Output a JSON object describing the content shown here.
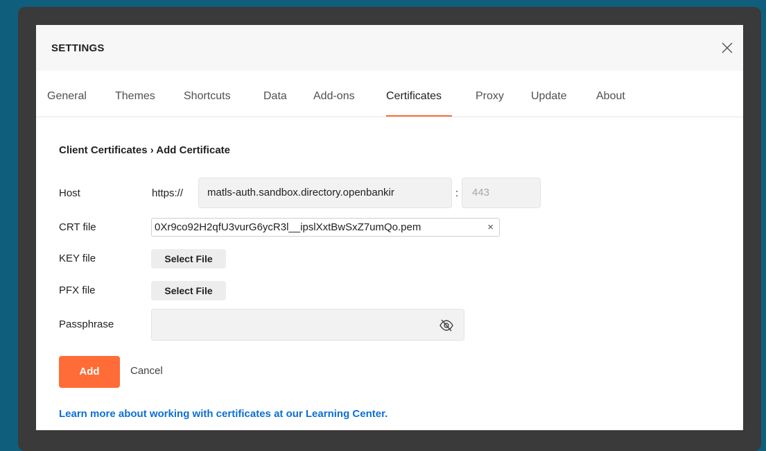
{
  "dialog": {
    "title": "SETTINGS",
    "close_icon": "close-icon"
  },
  "tabs": [
    {
      "label": "General"
    },
    {
      "label": "Themes"
    },
    {
      "label": "Shortcuts"
    },
    {
      "label": "Data"
    },
    {
      "label": "Add-ons"
    },
    {
      "label": "Certificates",
      "active": true
    },
    {
      "label": "Proxy"
    },
    {
      "label": "Update"
    },
    {
      "label": "About"
    }
  ],
  "breadcrumb": "Client Certificates › Add Certificate",
  "form": {
    "host_label": "Host",
    "protocol": "https://",
    "host_value": "matls-auth.sandbox.directory.openbankir",
    "colon": ":",
    "port_placeholder": "443",
    "crt_label": "CRT file",
    "crt_value": "0Xr9co92H2qfU3vurG6ycR3l__ipslXxtBwSxZ7umQo.pem",
    "crt_remove": "×",
    "key_label": "KEY file",
    "key_button": "Select File",
    "pfx_label": "PFX file",
    "pfx_button": "Select File",
    "passphrase_label": "Passphrase",
    "passphrase_value": "",
    "passphrase_icon": "eye-off-icon"
  },
  "actions": {
    "add_label": "Add",
    "cancel_label": "Cancel"
  },
  "learn_more": "Learn more about working with certificates at our Learning Center.",
  "colors": {
    "accent": "#ff6c37",
    "link": "#0c6fd6",
    "background": "#0f5f7c"
  }
}
